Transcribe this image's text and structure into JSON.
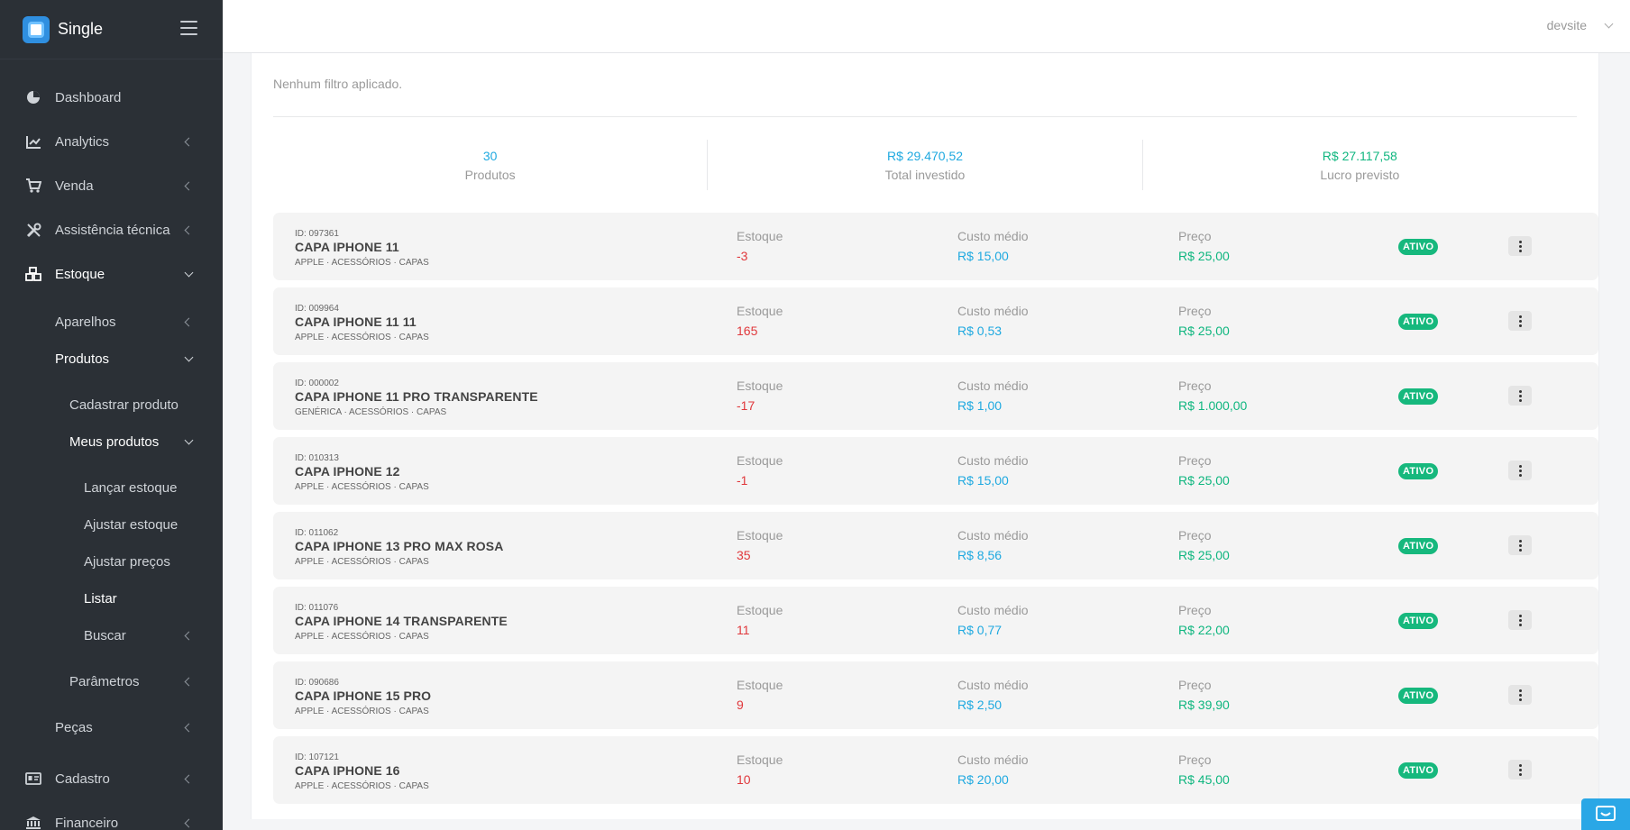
{
  "brand": {
    "name": "Single"
  },
  "sidebar": {
    "items": [
      {
        "key": "dashboard",
        "label": "Dashboard",
        "icon": "pie-chart-icon",
        "chevron": "none",
        "level": 0,
        "active": false
      },
      {
        "key": "analytics",
        "label": "Analytics",
        "icon": "line-chart-icon",
        "chevron": "left",
        "level": 0,
        "active": false
      },
      {
        "key": "venda",
        "label": "Venda",
        "icon": "cart-icon",
        "chevron": "left",
        "level": 0,
        "active": false
      },
      {
        "key": "assistencia",
        "label": "Assistência técnica",
        "icon": "tools-icon",
        "chevron": "left",
        "level": 0,
        "active": false
      },
      {
        "key": "estoque",
        "label": "Estoque",
        "icon": "boxes-icon",
        "chevron": "down",
        "level": 0,
        "active": true
      },
      {
        "key": "aparelhos",
        "label": "Aparelhos",
        "icon": "",
        "chevron": "left",
        "level": 1,
        "active": false
      },
      {
        "key": "produtos",
        "label": "Produtos",
        "icon": "",
        "chevron": "down",
        "level": 1,
        "active": true
      },
      {
        "key": "cadastrar-produto",
        "label": "Cadastrar produto",
        "icon": "",
        "chevron": "none",
        "level": 2,
        "active": false
      },
      {
        "key": "meus-produtos",
        "label": "Meus produtos",
        "icon": "",
        "chevron": "down",
        "level": 2,
        "active": true
      },
      {
        "key": "lancar-estoque",
        "label": "Lançar estoque",
        "icon": "",
        "chevron": "none",
        "level": 3,
        "active": false
      },
      {
        "key": "ajustar-estoque",
        "label": "Ajustar estoque",
        "icon": "",
        "chevron": "none",
        "level": 3,
        "active": false
      },
      {
        "key": "ajustar-precos",
        "label": "Ajustar preços",
        "icon": "",
        "chevron": "none",
        "level": 3,
        "active": false
      },
      {
        "key": "listar",
        "label": "Listar",
        "icon": "",
        "chevron": "none",
        "level": 3,
        "active": true
      },
      {
        "key": "buscar",
        "label": "Buscar",
        "icon": "",
        "chevron": "left",
        "level": 3,
        "active": false
      },
      {
        "key": "parametros",
        "label": "Parâmetros",
        "icon": "",
        "chevron": "left",
        "level": 2,
        "active": false
      },
      {
        "key": "pecas",
        "label": "Peças",
        "icon": "",
        "chevron": "left",
        "level": 1,
        "active": false
      },
      {
        "key": "cadastro",
        "label": "Cadastro",
        "icon": "id-card-icon",
        "chevron": "left",
        "level": 0,
        "active": false
      },
      {
        "key": "financeiro",
        "label": "Financeiro",
        "icon": "bank-icon",
        "chevron": "left",
        "level": 0,
        "active": false
      }
    ]
  },
  "header": {
    "user": "devsite"
  },
  "filters": {
    "text": "Nenhum filtro aplicado."
  },
  "summary": {
    "products_value": "30",
    "products_label": "Produtos",
    "invested_value": "R$ 29.470,52",
    "invested_label": "Total investido",
    "profit_value": "R$ 27.117,58",
    "profit_label": "Lucro previsto"
  },
  "columns": {
    "stock": "Estoque",
    "cost": "Custo médio",
    "price": "Preço"
  },
  "products": [
    {
      "id": "ID: 097361",
      "name": "CAPA IPHONE 11",
      "category": "APPLE · ACESSÓRIOS · CAPAS",
      "stock": "-3",
      "stock_negative": true,
      "cost": "R$ 15,00",
      "price": "R$ 25,00",
      "status": "ATIVO"
    },
    {
      "id": "ID: 009964",
      "name": "CAPA IPHONE 11 11",
      "category": "APPLE · ACESSÓRIOS · CAPAS",
      "stock": "165",
      "stock_negative": false,
      "cost": "R$ 0,53",
      "price": "R$ 25,00",
      "status": "ATIVO"
    },
    {
      "id": "ID: 000002",
      "name": "CAPA IPHONE 11 PRO TRANSPARENTE",
      "category": "GENÉRICA · ACESSÓRIOS · CAPAS",
      "stock": "-17",
      "stock_negative": true,
      "cost": "R$ 1,00",
      "price": "R$ 1.000,00",
      "status": "ATIVO"
    },
    {
      "id": "ID: 010313",
      "name": "CAPA IPHONE 12",
      "category": "APPLE · ACESSÓRIOS · CAPAS",
      "stock": "-1",
      "stock_negative": true,
      "cost": "R$ 15,00",
      "price": "R$ 25,00",
      "status": "ATIVO"
    },
    {
      "id": "ID: 011062",
      "name": "CAPA IPHONE 13 PRO MAX ROSA",
      "category": "APPLE · ACESSÓRIOS · CAPAS",
      "stock": "35",
      "stock_negative": false,
      "cost": "R$ 8,56",
      "price": "R$ 25,00",
      "status": "ATIVO"
    },
    {
      "id": "ID: 011076",
      "name": "CAPA IPHONE 14 TRANSPARENTE",
      "category": "APPLE · ACESSÓRIOS · CAPAS",
      "stock": "11",
      "stock_negative": false,
      "cost": "R$ 0,77",
      "price": "R$ 22,00",
      "status": "ATIVO"
    },
    {
      "id": "ID: 090686",
      "name": "CAPA IPHONE 15 PRO",
      "category": "APPLE · ACESSÓRIOS · CAPAS",
      "stock": "9",
      "stock_negative": false,
      "cost": "R$ 2,50",
      "price": "R$ 39,90",
      "status": "ATIVO"
    },
    {
      "id": "ID: 107121",
      "name": "CAPA IPHONE 16",
      "category": "APPLE · ACESSÓRIOS · CAPAS",
      "stock": "10",
      "stock_negative": false,
      "cost": "R$ 20,00",
      "price": "R$ 45,00",
      "status": "ATIVO"
    }
  ],
  "colors": {
    "sidebar": "#2b3036",
    "blue": "#1fa9e0",
    "green": "#0fb67f",
    "red": "#e0383c",
    "badge": "#16b87d"
  },
  "chat": {
    "icon": "chat-icon"
  }
}
